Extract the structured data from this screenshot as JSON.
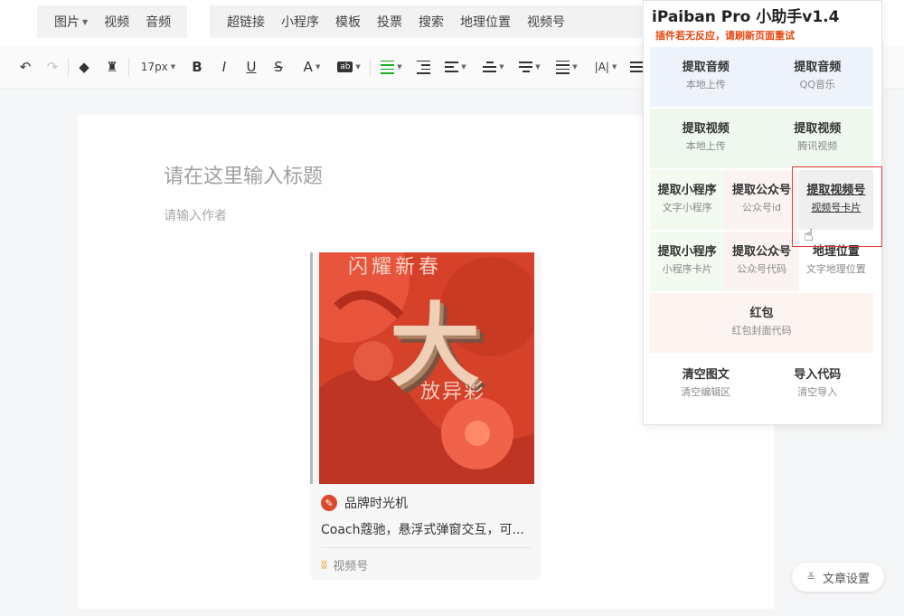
{
  "topbar": {
    "group1": [
      {
        "label": "图片",
        "dropdown": true
      },
      {
        "label": "视频",
        "dropdown": false
      },
      {
        "label": "音频",
        "dropdown": false
      }
    ],
    "group2": [
      {
        "label": "超链接"
      },
      {
        "label": "小程序"
      },
      {
        "label": "模板"
      },
      {
        "label": "投票"
      },
      {
        "label": "搜索"
      },
      {
        "label": "地理位置"
      },
      {
        "label": "视频号"
      }
    ]
  },
  "toolbar": {
    "font_size": "17px",
    "bold": "B",
    "italic": "I",
    "underline": "U",
    "strikethrough": "S",
    "font_color": "A",
    "background_color": "ab",
    "letter_spacing": "|A|"
  },
  "editor": {
    "title_placeholder": "请在这里输入标题",
    "author_placeholder": "请输入作者"
  },
  "video_card": {
    "poster_top": "闪耀新春",
    "poster_big": "大",
    "poster_bottom": "放异彩",
    "author": "品牌时光机",
    "description": "Coach蔻驰，悬浮式弹窗交互，可...",
    "source": "视频号"
  },
  "settings_button": {
    "label": "文章设置"
  },
  "panel": {
    "title": "iPaiban Pro 小助手v1.4",
    "notice": "插件若无反应，请刷新页面重试",
    "rows": [
      {
        "bg": "#eef3fb",
        "items": [
          {
            "title": "提取音频",
            "sub": "本地上传"
          },
          {
            "title": "提取音频",
            "sub": "QQ音乐"
          }
        ]
      },
      {
        "bg": "#eef8ee",
        "items": [
          {
            "title": "提取视频",
            "sub": "本地上传"
          },
          {
            "title": "提取视频",
            "sub": "腾讯视频"
          }
        ]
      },
      {
        "items": [
          {
            "title": "提取小程序",
            "sub": "文字小程序",
            "bg": "#f3faf0"
          },
          {
            "title": "提取公众号",
            "sub": "公众号id",
            "bg": "#fbf3f1"
          },
          {
            "title": "提取视频号",
            "sub": "视频号卡片",
            "bg": "#efefef",
            "hovered": true
          }
        ]
      },
      {
        "items": [
          {
            "title": "提取小程序",
            "sub": "小程序卡片",
            "bg": "#f3faf0"
          },
          {
            "title": "提取公众号",
            "sub": "公众号代码",
            "bg": "#fbf3f1"
          },
          {
            "title": "地理位置",
            "sub": "文字地理位置",
            "bg": "#ffffff"
          }
        ]
      },
      {
        "bg": "#fdf3f0",
        "items": [
          {
            "title": "红包",
            "sub": "红包封面代码"
          }
        ]
      },
      {
        "bg": "#ffffff",
        "items": [
          {
            "title": "清空图文",
            "sub": "清空编辑区"
          },
          {
            "title": "导入代码",
            "sub": "清空导入"
          }
        ]
      }
    ]
  }
}
